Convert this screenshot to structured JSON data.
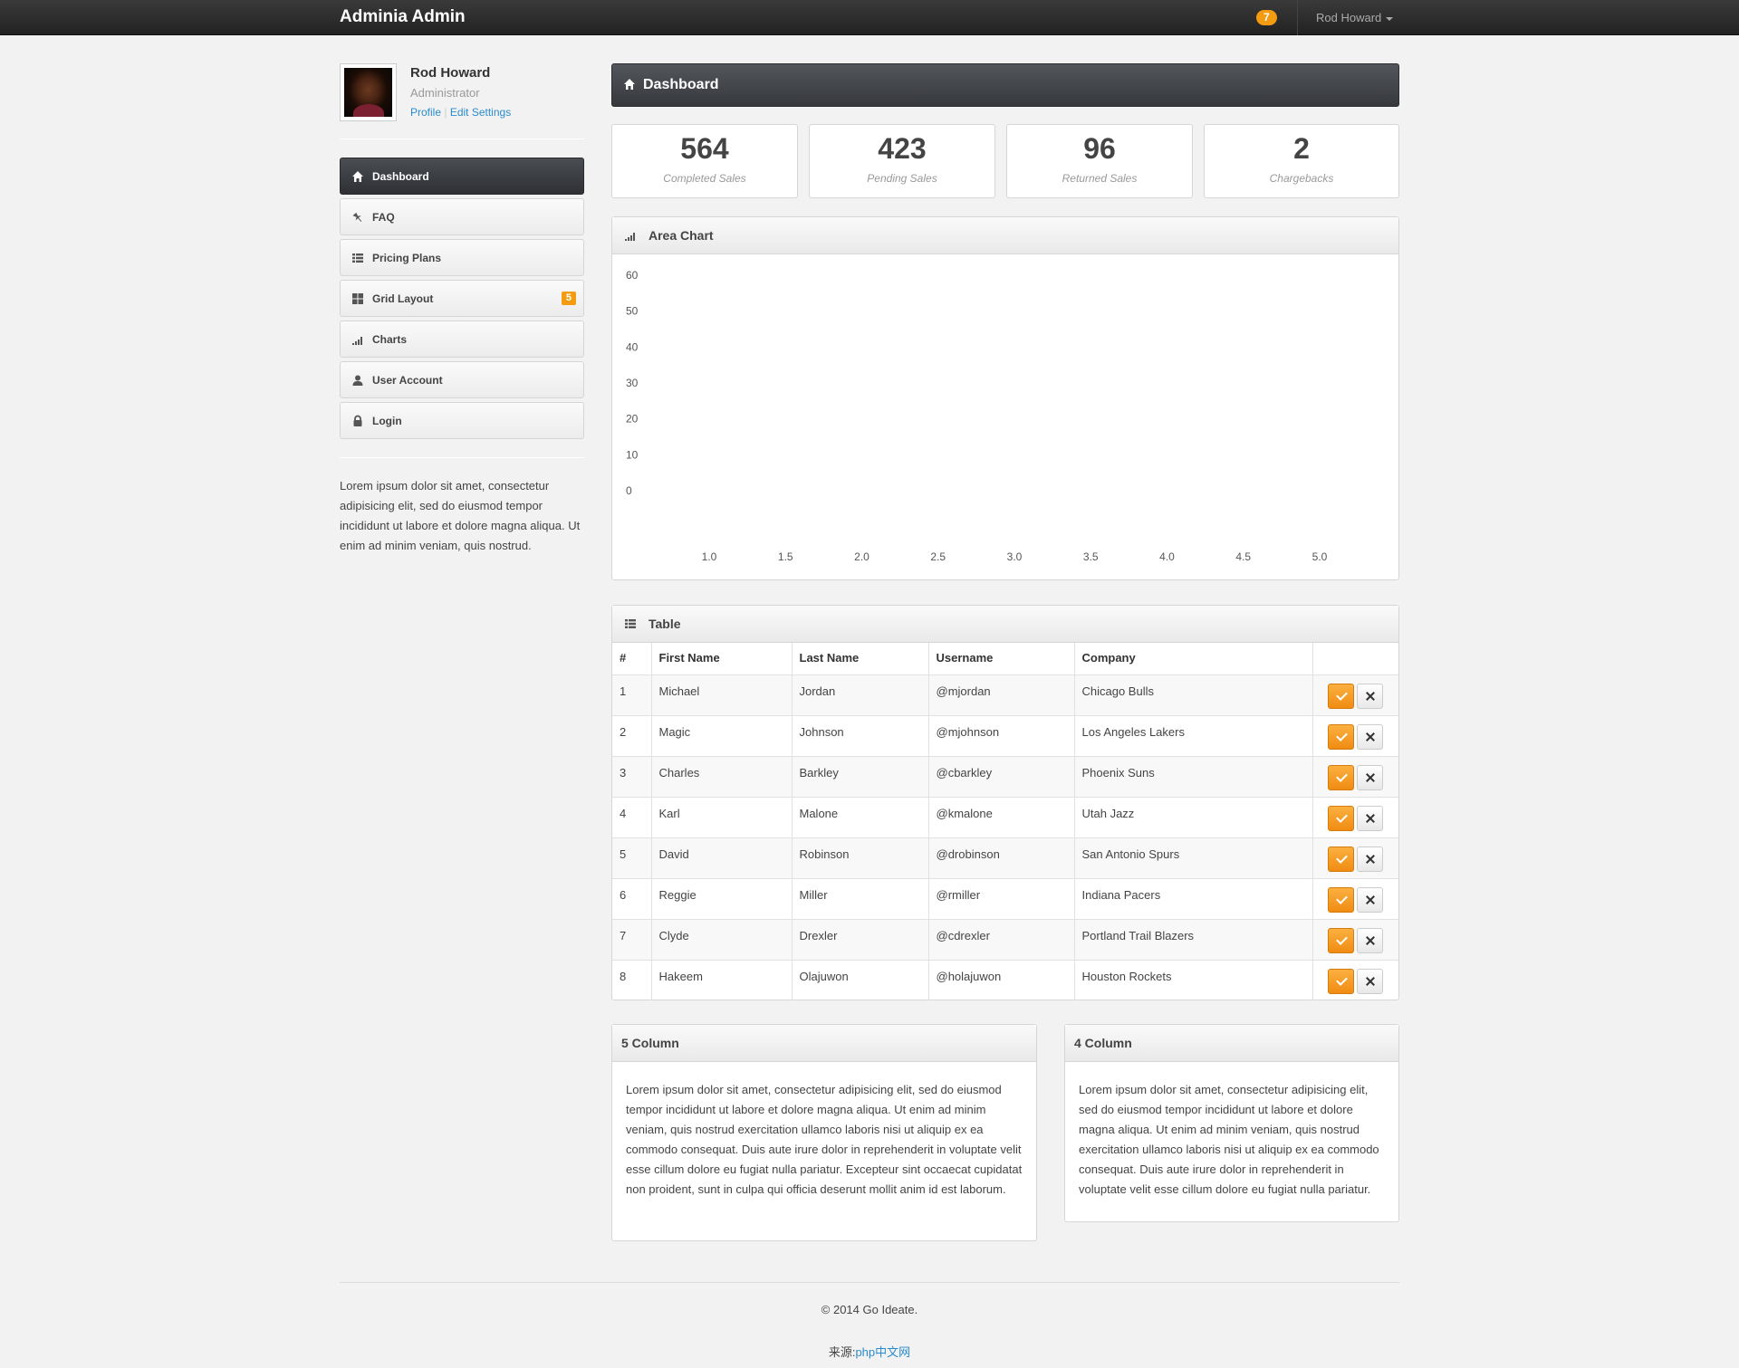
{
  "navbar": {
    "brand": "Adminia Admin",
    "notification_count": "7",
    "user_menu": "Rod Howard"
  },
  "profile": {
    "name": "Rod Howard",
    "role": "Administrator",
    "link_profile": "Profile",
    "link_separator": "|",
    "link_settings": "Edit Settings"
  },
  "sidebar": {
    "items": [
      {
        "label": "Dashboard",
        "icon": "home-icon",
        "active": true
      },
      {
        "label": "FAQ",
        "icon": "pushpin-icon"
      },
      {
        "label": "Pricing Plans",
        "icon": "list-icon"
      },
      {
        "label": "Grid Layout",
        "icon": "grid-icon",
        "badge": "5"
      },
      {
        "label": "Charts",
        "icon": "signal-icon"
      },
      {
        "label": "User Account",
        "icon": "user-icon"
      },
      {
        "label": "Login",
        "icon": "lock-icon"
      }
    ],
    "text": "Lorem ipsum dolor sit amet, consectetur adipisicing elit, sed do eiusmod tempor incididunt ut labore et dolore magna aliqua. Ut enim ad minim veniam, quis nostrud."
  },
  "dashboard": {
    "title": "Dashboard",
    "stats": [
      {
        "value": "564",
        "label": "Completed Sales"
      },
      {
        "value": "423",
        "label": "Pending Sales"
      },
      {
        "value": "96",
        "label": "Returned Sales"
      },
      {
        "value": "2",
        "label": "Chargebacks"
      }
    ]
  },
  "area_chart": {
    "title": "Area Chart"
  },
  "chart_data": {
    "type": "area",
    "title": "Area Chart",
    "x": [
      1.0,
      1.5,
      2.0,
      2.5,
      3.0,
      3.5,
      4.0,
      4.5,
      5.0
    ],
    "x_tick_labels": [
      "1.0",
      "1.5",
      "2.0",
      "2.5",
      "3.0",
      "3.5",
      "4.0",
      "4.5",
      "5.0"
    ],
    "y_tick_labels": [
      "60",
      "50",
      "40",
      "30",
      "20",
      "10",
      "0"
    ],
    "ylim": [
      0,
      60
    ],
    "series": [],
    "grid": false
  },
  "table": {
    "title": "Table",
    "headers": [
      "#",
      "First Name",
      "Last Name",
      "Username",
      "Company",
      ""
    ],
    "rows": [
      [
        "1",
        "Michael",
        "Jordan",
        "@mjordan",
        "Chicago Bulls"
      ],
      [
        "2",
        "Magic",
        "Johnson",
        "@mjohnson",
        "Los Angeles Lakers"
      ],
      [
        "3",
        "Charles",
        "Barkley",
        "@cbarkley",
        "Phoenix Suns"
      ],
      [
        "4",
        "Karl",
        "Malone",
        "@kmalone",
        "Utah Jazz"
      ],
      [
        "5",
        "David",
        "Robinson",
        "@drobinson",
        "San Antonio Spurs"
      ],
      [
        "6",
        "Reggie",
        "Miller",
        "@rmiller",
        "Indiana Pacers"
      ],
      [
        "7",
        "Clyde",
        "Drexler",
        "@cdrexler",
        "Portland Trail Blazers"
      ],
      [
        "8",
        "Hakeem",
        "Olajuwon",
        "@holajuwon",
        "Houston Rockets"
      ]
    ]
  },
  "five_column": {
    "title": "5 Column",
    "text": "Lorem ipsum dolor sit amet, consectetur adipisicing elit, sed do eiusmod tempor incididunt ut labore et dolore magna aliqua. Ut enim ad minim veniam, quis nostrud exercitation ullamco laboris nisi ut aliquip ex ea commodo consequat. Duis aute irure dolor in reprehenderit in voluptate velit esse cillum dolore eu fugiat nulla pariatur. Excepteur sint occaecat cupidatat non proident, sunt in culpa qui officia deserunt mollit anim id est laborum."
  },
  "four_column": {
    "title": "4 Column",
    "text": "Lorem ipsum dolor sit amet, consectetur adipisicing elit, sed do eiusmod tempor incididunt ut labore et dolore magna aliqua. Ut enim ad minim veniam, quis nostrud exercitation ullamco laboris nisi ut aliquip ex ea commodo consequat. Duis aute irure dolor in reprehenderit in voluptate velit esse cillum dolore eu fugiat nulla pariatur."
  },
  "footer": {
    "copyright": "© 2014 Go Ideate.",
    "source_label": "来源:",
    "source_link": "php中文网"
  },
  "colors": {
    "accent": "#f39c12",
    "link": "#2a8bcc",
    "navbar": "#2b2b2b"
  }
}
